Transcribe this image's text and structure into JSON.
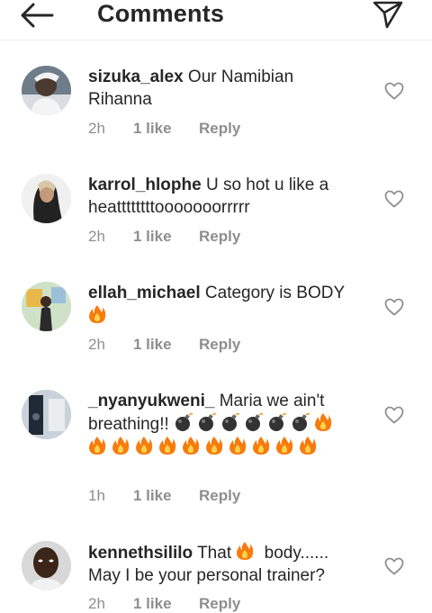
{
  "header": {
    "title": "Comments",
    "back_icon": "arrow-left-icon",
    "send_icon": "paper-plane-icon"
  },
  "colors": {
    "text": "#262626",
    "meta": "#8e8e8e",
    "fire": "#f77b0e",
    "bomb": "#333333"
  },
  "comments": [
    {
      "username": "sizuka_alex",
      "text": "Our Namibian Rihanna",
      "time": "2h",
      "likes": "1 like",
      "reply": "Reply"
    },
    {
      "username": "karrol_hlophe",
      "text": "U so hot u like a heattttttttooooooorrrrr",
      "time": "2h",
      "likes": "1 like",
      "reply": "Reply"
    },
    {
      "username": "ellah_michael",
      "text": "Category is BODY",
      "time": "2h",
      "likes": "1 like",
      "reply": "Reply"
    },
    {
      "username": "_nyanyukweni_",
      "text": "Maria we ain't breathing!!",
      "time": "1h",
      "likes": "1 like",
      "reply": "Reply"
    },
    {
      "username": "kennethsililo",
      "text_before": "That",
      "text_after": "body...... May I be your personal trainer?",
      "time": "2h",
      "likes": "1 like",
      "reply": "Reply"
    }
  ]
}
